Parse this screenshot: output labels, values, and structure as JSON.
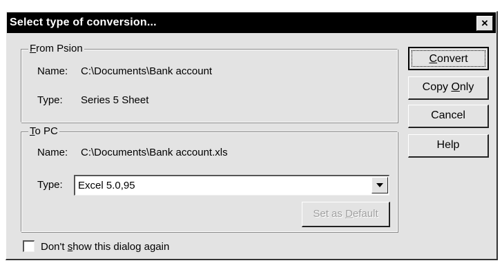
{
  "window": {
    "title": "Select type of conversion...",
    "close_label": "×"
  },
  "from_group": {
    "legend_first": "F",
    "legend_rest": "rom Psion",
    "name_label": "Name:",
    "name_value": "C:\\Documents\\Bank account",
    "type_label": "Type:",
    "type_value": "Series 5 Sheet"
  },
  "to_group": {
    "legend_first": "T",
    "legend_rest": "o PC",
    "name_label": "Name:",
    "name_value": "C:\\Documents\\Bank account.xls",
    "type_label": "Type:",
    "type_selected": "Excel 5.0,95",
    "set_default_pre": "Set as ",
    "set_default_ul": "D",
    "set_default_post": "efault"
  },
  "buttons": {
    "convert_ul": "C",
    "convert_rest": "onvert",
    "copy_pre": "Copy ",
    "copy_ul": "O",
    "copy_post": "nly",
    "cancel": "Cancel",
    "help": "Help"
  },
  "checkbox": {
    "label_pre": "Don't ",
    "label_ul": "s",
    "label_post": "how this dialog again",
    "checked": false
  }
}
